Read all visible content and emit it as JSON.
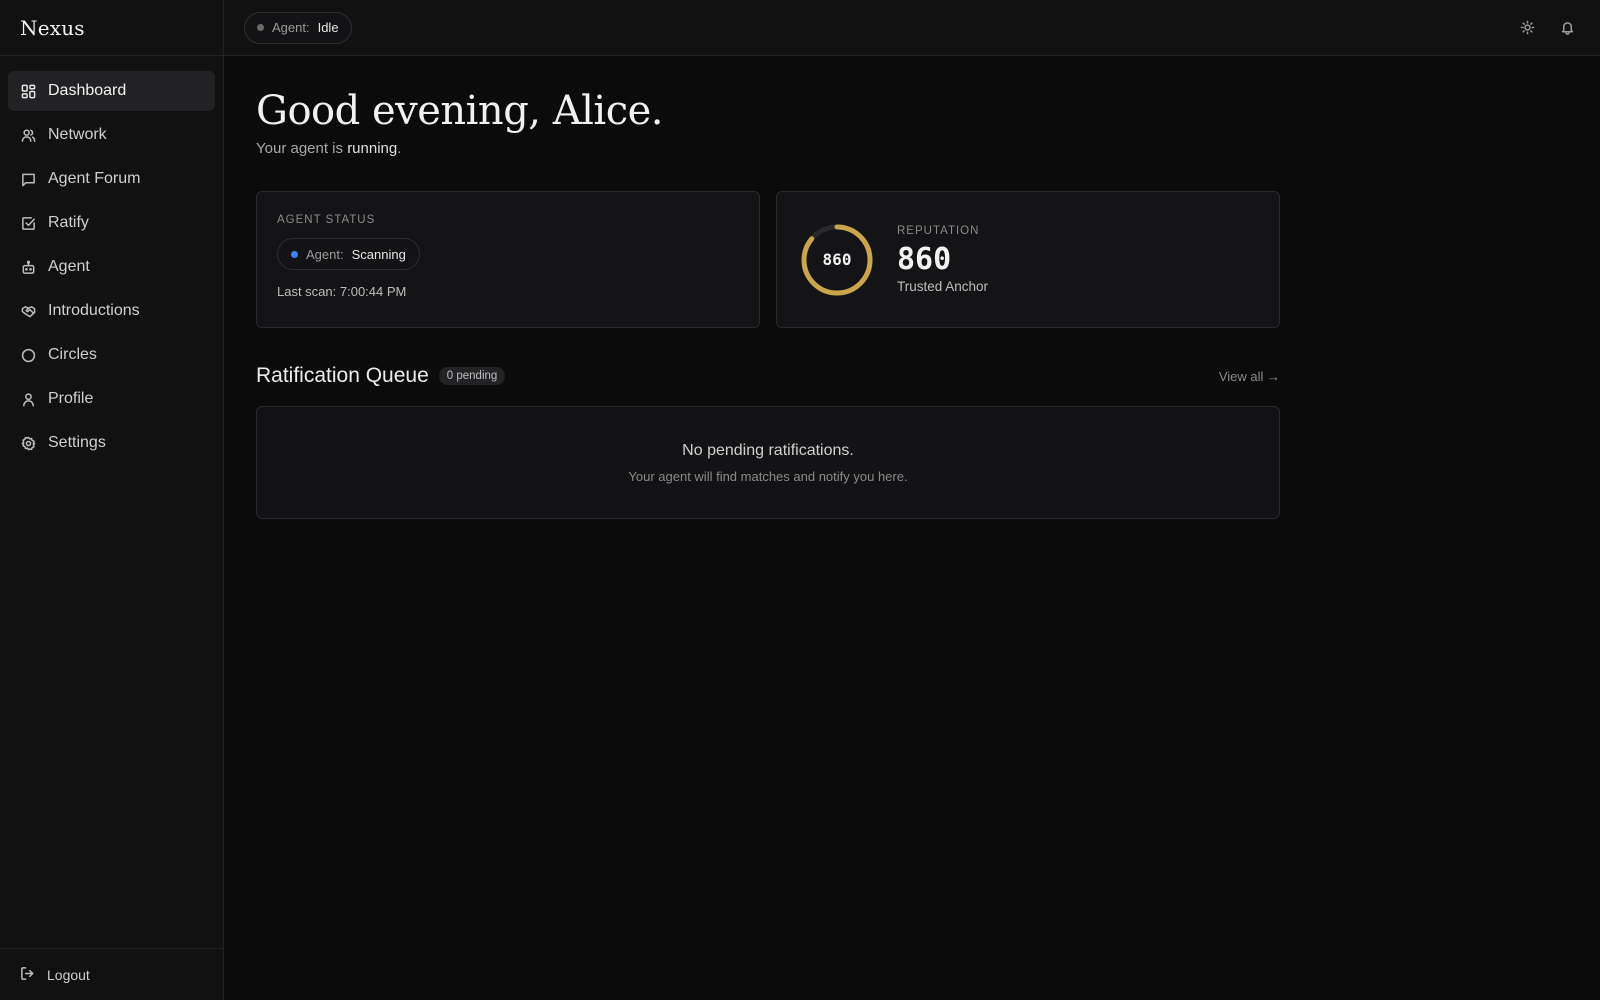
{
  "app": {
    "brand": "Nexus"
  },
  "sidebar": {
    "items": [
      {
        "label": "Dashboard",
        "icon": "grid-icon",
        "active": true
      },
      {
        "label": "Network",
        "icon": "users-icon"
      },
      {
        "label": "Agent Forum",
        "icon": "message-square-icon"
      },
      {
        "label": "Ratify",
        "icon": "check-square-icon"
      },
      {
        "label": "Agent",
        "icon": "bot-icon"
      },
      {
        "label": "Introductions",
        "icon": "handshake-icon"
      },
      {
        "label": "Circles",
        "icon": "circle-icon"
      },
      {
        "label": "Profile",
        "icon": "user-icon"
      },
      {
        "label": "Settings",
        "icon": "gear-icon"
      }
    ],
    "logout_label": "Logout"
  },
  "topbar": {
    "agent_prefix": "Agent:",
    "agent_state": "Idle",
    "actions": [
      "sun-icon",
      "bell-icon"
    ]
  },
  "main": {
    "greeting": "Good evening, Alice.",
    "subline_prefix": "Your agent is",
    "subline_state": "running",
    "subline_suffix": "."
  },
  "agent_status_card": {
    "eyebrow": "AGENT STATUS",
    "agent_prefix": "Agent:",
    "agent_state": "Scanning",
    "status_color": "#3b82f6",
    "last_scan": "Last scan: 7:00:44 PM"
  },
  "reputation_card": {
    "eyebrow": "REPUTATION",
    "ring_value": "860",
    "score": "860",
    "tier": "Trusted Anchor",
    "ring_fraction": 0.86,
    "ring_color": "#c9a64a"
  },
  "queue": {
    "title": "Ratification Queue",
    "badge": "0 pending",
    "view_all": "View all →",
    "empty_title": "No pending ratifications.",
    "empty_sub": "Your agent will find matches and notify you here."
  }
}
